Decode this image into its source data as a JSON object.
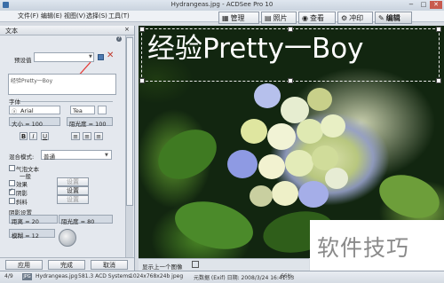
{
  "window": {
    "title": "Hydrangeas.jpg - ACDSee Pro 10",
    "controls": [
      "−",
      "□",
      "✕"
    ]
  },
  "menu": [
    "文件(F)",
    "编辑(E)",
    "视图(V)",
    "选择(S)",
    "工具(T)"
  ],
  "modes": [
    {
      "label": "管理",
      "icon": "grid-icon"
    },
    {
      "label": "照片",
      "icon": "photos-icon"
    },
    {
      "label": "查看",
      "icon": "eye-icon"
    },
    {
      "label": "冲印",
      "icon": "develop-icon"
    },
    {
      "label": "编辑",
      "icon": "edit-icon"
    }
  ],
  "panel": {
    "title": "文本",
    "preset_label": "预设值",
    "text_value": "经验Pretty一Boy",
    "font_section": "字体",
    "font_name": "Arial",
    "font_size": "Tea",
    "size_label": "大小 = 100",
    "opacity_label": "阻光度 = 100",
    "bold": "B",
    "italic": "I",
    "underline": "U",
    "blend_label": "混合模式:",
    "blend_value": "普通",
    "bubble_label": "气泡文本",
    "bubble_sub": "一般",
    "effect_label": "效果",
    "shadow_label": "阴影",
    "bevel_label": "斜料",
    "settings_label": "设置",
    "shadow_section": "阴影设置",
    "distance_label": "距离 = 20",
    "shadow_opacity_label": "阻光度 = 80",
    "blur_label": "模糊 = 12",
    "apply": "应用",
    "done": "完成",
    "cancel": "取消"
  },
  "image": {
    "overlay_text": "经验Pretty一Boy",
    "nav_label": "显示上一个图像"
  },
  "watermark": "软件技巧",
  "status": {
    "index": "4/9",
    "format": "JPG",
    "filename": "Hydrangeas.jpg",
    "filesize": "581.3 ACD Systems",
    "dimensions": "1024x768x24b jpeg",
    "modified": "元数据 (Exif) 日期: 2008/3/24 16:41:53",
    "zoom": "66%"
  }
}
